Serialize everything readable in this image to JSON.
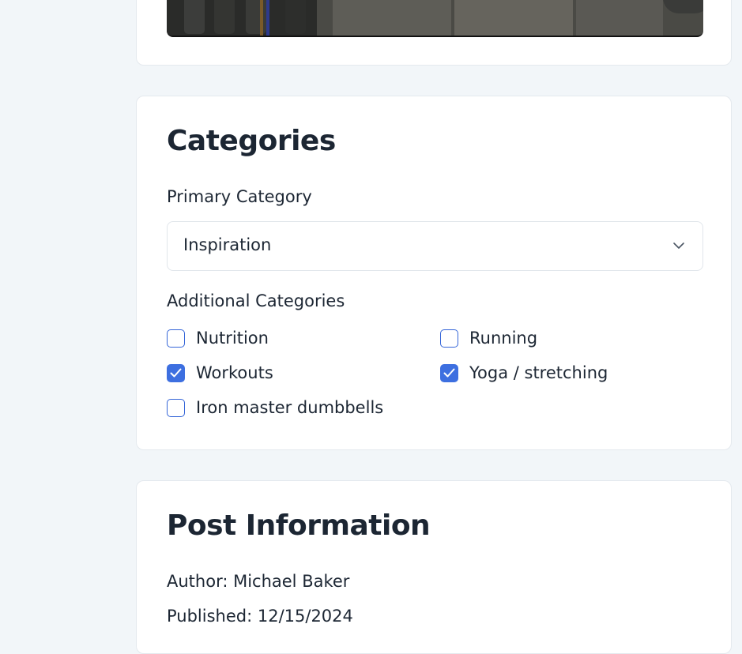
{
  "image_card": {
    "preview_alt": "Home gym floor with dumbbells"
  },
  "categories": {
    "title": "Categories",
    "primary_label": "Primary Category",
    "primary_value": "Inspiration",
    "additional_label": "Additional Categories",
    "options": [
      {
        "label": "Nutrition",
        "checked": false
      },
      {
        "label": "Running",
        "checked": false
      },
      {
        "label": "Workouts",
        "checked": true
      },
      {
        "label": "Yoga / stretching",
        "checked": true
      },
      {
        "label": "Iron master dumbbells",
        "checked": false
      }
    ]
  },
  "post_info": {
    "title": "Post Information",
    "author": "Author: Michael Baker",
    "published": "Published: 12/15/2024"
  },
  "colors": {
    "accent": "#3d6fe0",
    "background": "#f2f6f9",
    "text": "#1c2633"
  },
  "icons": {
    "select_chevron": "chevron-down-icon",
    "check": "checkmark-icon"
  }
}
